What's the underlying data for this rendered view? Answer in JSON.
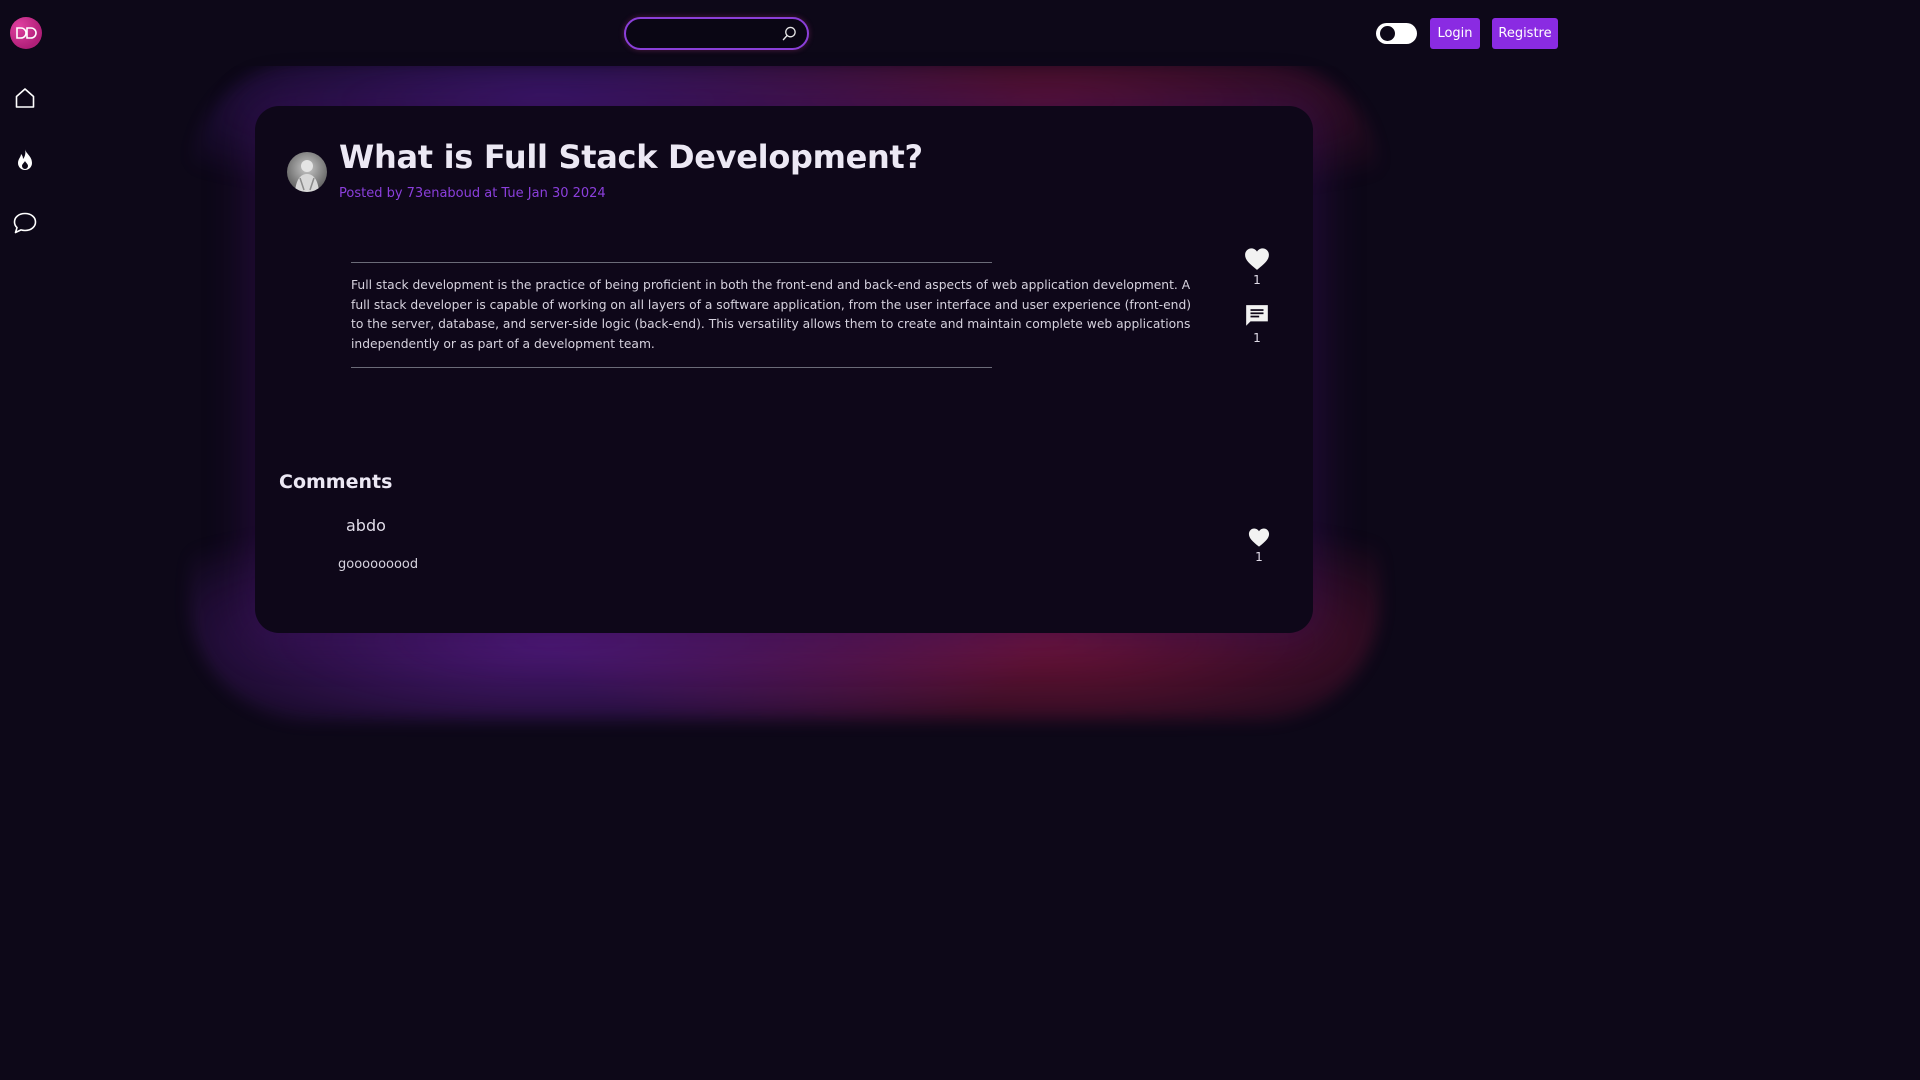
{
  "header": {
    "search": {
      "placeholder": "",
      "value": ""
    },
    "theme_toggle": {
      "state": "dark"
    },
    "login_label": "Login",
    "register_label": "Registre"
  },
  "sidebar": {
    "items": [
      {
        "name": "home",
        "icon": "home-icon"
      },
      {
        "name": "trending",
        "icon": "fire-icon"
      },
      {
        "name": "chat",
        "icon": "chat-bubble-icon"
      }
    ]
  },
  "post": {
    "title": "What is Full Stack Development?",
    "meta": "Posted by 73enaboud at Tue Jan 30 2024",
    "body": "Full stack development is the practice of being proficient in both the front-end and back-end aspects of web application development. A full stack developer is capable of working on all layers of a software application, from the user interface and user experience (front-end) to the server, database, and server-side logic (back-end). This versatility allows them to create and maintain complete web applications independently or as part of a development team.",
    "likes": "1",
    "comments": "1"
  },
  "comments": {
    "heading": "Comments",
    "items": [
      {
        "author": "abdo",
        "text": "gooooooood",
        "likes": "1"
      }
    ]
  },
  "colors": {
    "background": "#0d0818",
    "card": "#0e0719",
    "accent": "#8a2be2",
    "meta_text": "#8b3fdc",
    "logo": "#c0268a"
  }
}
